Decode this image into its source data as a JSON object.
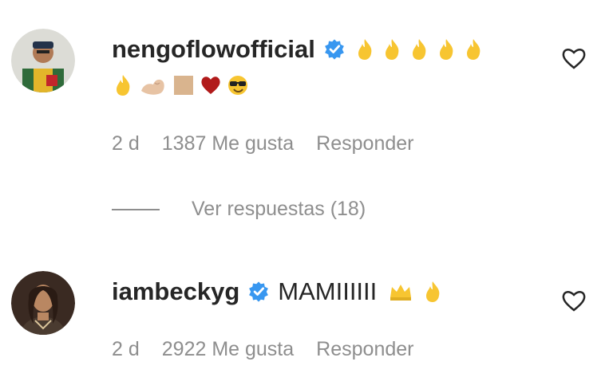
{
  "comments": [
    {
      "username": "nengoflowofficial",
      "text": "",
      "time": "2 d",
      "likes": "1387 Me gusta",
      "reply_label": "Responder",
      "emoji_line1": [
        "fire-icon",
        "fire-icon",
        "fire-icon",
        "fire-icon",
        "fire-icon"
      ],
      "emoji_line2": [
        "fire-icon",
        "flexed-biceps-icon",
        "square-icon",
        "heart-icon",
        "sunglasses-face-icon"
      ]
    },
    {
      "username": "iambeckyg",
      "text": "MAMIIIIII",
      "time": "2 d",
      "likes": "2922 Me gusta",
      "reply_label": "Responder",
      "emoji_line1": [
        "crown-icon",
        "fire-icon"
      ]
    }
  ],
  "view_replies_label": "Ver respuestas (18)",
  "colors": {
    "text": "#262626",
    "muted": "#8e8e8e",
    "verified": "#3897f0",
    "fire": "#f7c531",
    "heart_red": "#b11a1a",
    "skin": "#e7c3a4"
  }
}
